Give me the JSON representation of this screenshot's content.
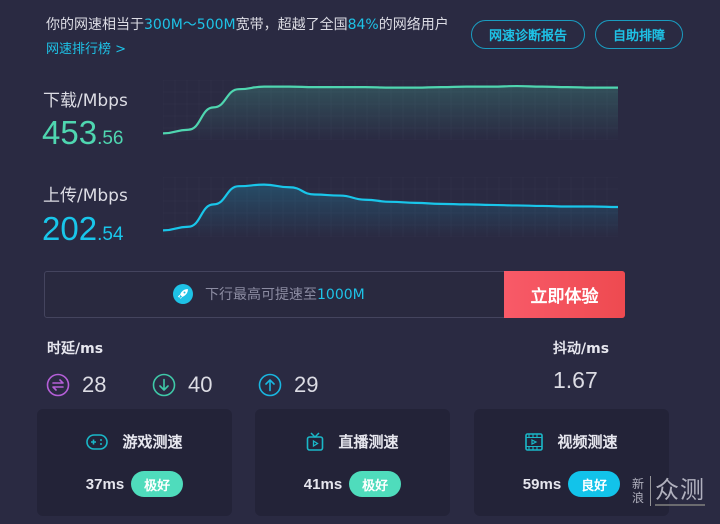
{
  "summary": {
    "prefix": "你的网速相当于",
    "range": "300M～500M",
    "middle": "宽带，超越了全国",
    "percent": "84%",
    "suffix": "的网络用户",
    "rank_link": "网速排行榜 >"
  },
  "header_buttons": {
    "report": "网速诊断报告",
    "self_help": "自助排障"
  },
  "download": {
    "label": "下载/Mbps",
    "int": "453",
    "dec": ".56",
    "color": "#4fd6b0",
    "curve": [
      0.05,
      0.12,
      0.55,
      0.9,
      0.95,
      0.95,
      0.94,
      0.94,
      0.94,
      0.93,
      0.93,
      0.94,
      0.95,
      0.95,
      0.96,
      0.95,
      0.94,
      0.93,
      0.93
    ]
  },
  "upload": {
    "label": "上传/Mbps",
    "int": "202",
    "dec": ".54",
    "color": "#19c6ea",
    "curve": [
      0.05,
      0.12,
      0.55,
      0.9,
      0.93,
      0.88,
      0.74,
      0.72,
      0.64,
      0.6,
      0.58,
      0.56,
      0.55,
      0.54,
      0.53,
      0.52,
      0.51,
      0.51,
      0.5
    ]
  },
  "boost": {
    "prefix": "下行最高可提速至",
    "speed": "1000M",
    "button": "立即体验"
  },
  "latency": {
    "label": "时延/ms",
    "items": [
      {
        "icon": "swap-icon",
        "value": "28",
        "color": "#b55fd8"
      },
      {
        "icon": "down-arrow-icon",
        "value": "40",
        "color": "#3fc9a8"
      },
      {
        "icon": "up-arrow-icon",
        "value": "29",
        "color": "#19b6e0"
      }
    ]
  },
  "jitter": {
    "label": "抖动/ms",
    "value": "1.67"
  },
  "cards": [
    {
      "title": "游戏测速",
      "ms": "37ms",
      "badge": "极好",
      "badge_color": "#4fdcbc",
      "icon": "gamepad-icon"
    },
    {
      "title": "直播测速",
      "ms": "41ms",
      "badge": "极好",
      "badge_color": "#4fdcbc",
      "icon": "tv-icon"
    },
    {
      "title": "视频测速",
      "ms": "59ms",
      "badge": "良好",
      "badge_color": "#12c3ea",
      "icon": "film-icon"
    }
  ],
  "watermark": {
    "small": "新浪",
    "big": "众测"
  }
}
